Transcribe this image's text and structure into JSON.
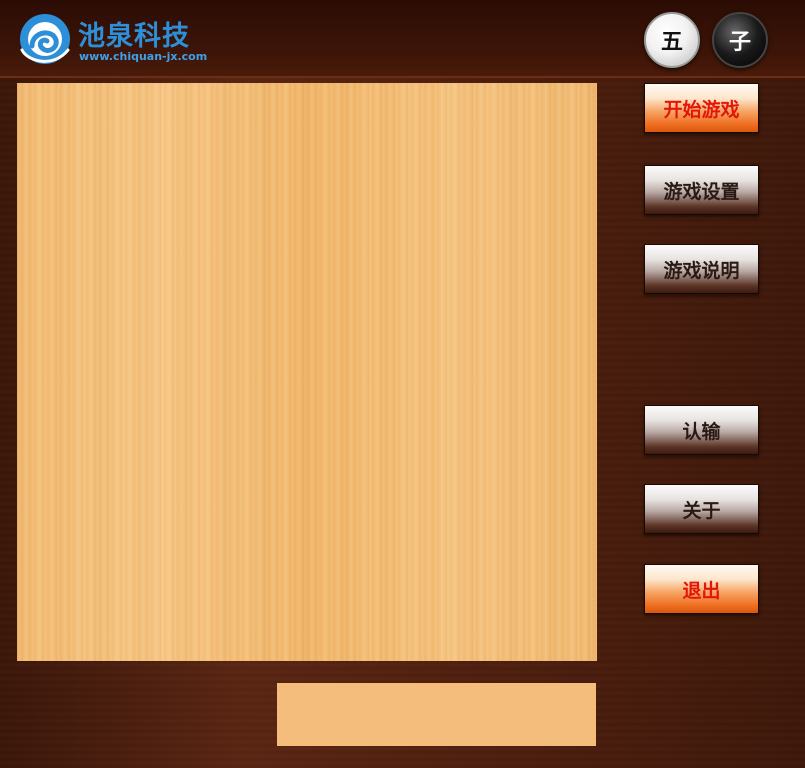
{
  "header": {
    "company_name": "池泉科技",
    "company_url": "www.chiquan-jx.com",
    "stones": [
      "五",
      "子"
    ]
  },
  "sidebar": {
    "buttons": [
      {
        "label": "开始游戏",
        "style": "orange"
      },
      {
        "label": "游戏设置",
        "style": "dark"
      },
      {
        "label": "游戏说明",
        "style": "dark"
      },
      {
        "label": "认输",
        "style": "dark"
      },
      {
        "label": "关于",
        "style": "dark"
      },
      {
        "label": "退出",
        "style": "orange"
      }
    ]
  },
  "status": {
    "message": ""
  },
  "colors": {
    "logo_blue": "#2d8fd8",
    "button_red_text": "#e4160a",
    "board_wood": "#f2bd77",
    "frame_wood": "#5a2412"
  }
}
